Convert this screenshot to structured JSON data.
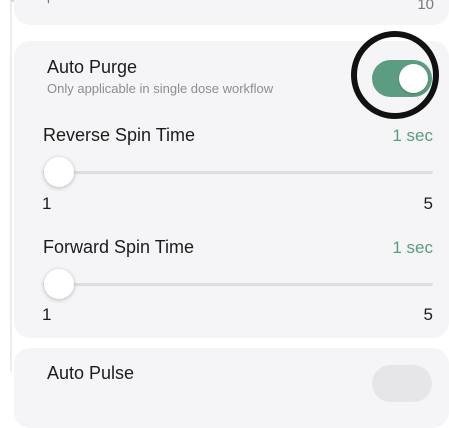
{
  "top_card": {
    "left_text": "'",
    "right_text": "10"
  },
  "auto_purge": {
    "title": "Auto Purge",
    "subtitle": "Only applicable in single dose workflow",
    "enabled": true
  },
  "reverse_spin": {
    "label": "Reverse Spin Time",
    "value": "1 sec",
    "min": "1",
    "max": "5",
    "level": 0
  },
  "forward_spin": {
    "label": "Forward Spin Time",
    "value": "1 sec",
    "min": "1",
    "max": "5",
    "level": 0
  },
  "auto_pulse": {
    "title": "Auto Pulse",
    "enabled": false
  },
  "colors": {
    "accent": "#5c9c80",
    "card_background": "#f5f5f7"
  }
}
